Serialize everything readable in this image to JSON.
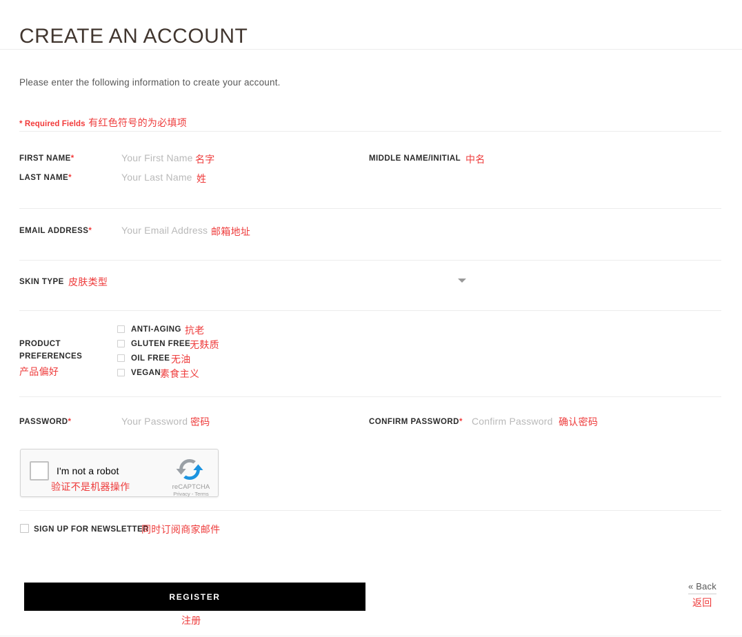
{
  "page": {
    "title": "CREATE AN ACCOUNT",
    "intro": "Please enter the following information to create your account.",
    "required_note": "* Required Fields",
    "required_note_cn": "有红色符号的为必填项"
  },
  "fields": {
    "first_name": {
      "label": "FIRST NAME",
      "required_marker": "*",
      "placeholder": "Your First Name",
      "cn": "名字"
    },
    "last_name": {
      "label": "LAST NAME",
      "required_marker": "*",
      "placeholder": "Your Last Name",
      "cn": "姓"
    },
    "middle_name": {
      "label": "MIDDLE NAME/INITIAL",
      "cn": "中名"
    },
    "email": {
      "label": "EMAIL ADDRESS",
      "required_marker": "*",
      "placeholder": "Your Email Address",
      "cn": "邮箱地址"
    },
    "skin_type": {
      "label": "SKIN TYPE",
      "cn": "皮肤类型",
      "selected": ""
    },
    "password": {
      "label": "PASSWORD",
      "required_marker": "*",
      "placeholder": "Your Password",
      "cn": "密码"
    },
    "confirm_password": {
      "label": "CONFIRM PASSWORD",
      "required_marker": "*",
      "placeholder": "Confirm Password",
      "cn": "确认密码"
    }
  },
  "product_preferences": {
    "label_line1": "PRODUCT",
    "label_line2": "PREFERENCES",
    "label_cn": "产品偏好",
    "options": [
      {
        "label": "ANTI-AGING",
        "cn": "抗老",
        "checked": false
      },
      {
        "label": "GLUTEN FREE",
        "cn": "无麸质",
        "checked": false
      },
      {
        "label": "OIL FREE",
        "cn": "无油",
        "checked": false
      },
      {
        "label": "VEGAN",
        "cn": "素食主义",
        "checked": false
      }
    ]
  },
  "recaptcha": {
    "checkbox_label": "I'm not a robot",
    "checkbox_cn": "验证不是机器操作",
    "brand": "reCAPTCHA",
    "legal": "Privacy - Terms",
    "checked": false
  },
  "newsletter": {
    "label": "SIGN UP FOR NEWSLETTER",
    "cn": "同时订阅商家邮件",
    "checked": false
  },
  "actions": {
    "register_label": "REGISTER",
    "register_cn": "注册",
    "back_label": "« Back",
    "back_cn": "返回"
  },
  "colors": {
    "accent_red": "#ee3b3b",
    "required_red": "#f23a3a",
    "button_bg": "#000000",
    "rule": "#ececec"
  }
}
